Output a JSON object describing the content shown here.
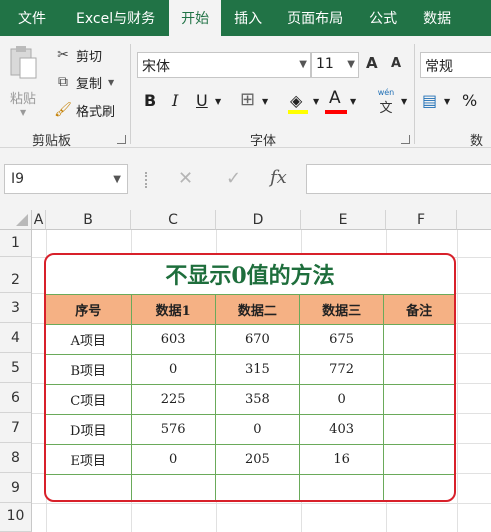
{
  "tabs": [
    "文件",
    "Excel与财务",
    "开始",
    "插入",
    "页面布局",
    "公式",
    "数据"
  ],
  "active_tab": "开始",
  "clipboard": {
    "paste": "粘贴",
    "cut": "剪切",
    "copy": "复制",
    "format_painter": "格式刷",
    "group_label": "剪贴板"
  },
  "font": {
    "name": "宋体",
    "size": "11",
    "group_label": "字体",
    "bold": "B",
    "italic": "I",
    "underline": "U",
    "grow": "A",
    "shrink": "A",
    "color_letter": "A",
    "phonetic_top": "wén",
    "phonetic_bottom": "文",
    "fill_color": "#ffff00",
    "font_color": "#ff0000"
  },
  "number": {
    "format": "常规",
    "percent": "%",
    "group_label": "数字"
  },
  "formula_bar": {
    "name_box": "I9",
    "fx": "fx",
    "value": ""
  },
  "columns": [
    "A",
    "B",
    "C",
    "D",
    "E",
    "F"
  ],
  "rows": [
    "1",
    "2",
    "3",
    "4",
    "5",
    "6",
    "7",
    "8",
    "9",
    "10"
  ],
  "sheet": {
    "title": "不显示0值的方法",
    "headers": [
      "序号",
      "数据1",
      "数据二",
      "数据三",
      "备注"
    ],
    "data_rows": [
      [
        "A项目",
        "603",
        "670",
        "675",
        ""
      ],
      [
        "B项目",
        "0",
        "315",
        "772",
        ""
      ],
      [
        "C项目",
        "225",
        "358",
        "0",
        ""
      ],
      [
        "D项目",
        "576",
        "0",
        "403",
        ""
      ],
      [
        "E项目",
        "0",
        "205",
        "16",
        ""
      ],
      [
        "",
        "",
        "",
        "",
        ""
      ]
    ]
  },
  "colors": {
    "ribbon_green": "#217346",
    "header_fill": "#f5b184",
    "title_text": "#1e6e3c",
    "frame_border": "#d8202a",
    "cell_border": "#6aaa5a"
  }
}
